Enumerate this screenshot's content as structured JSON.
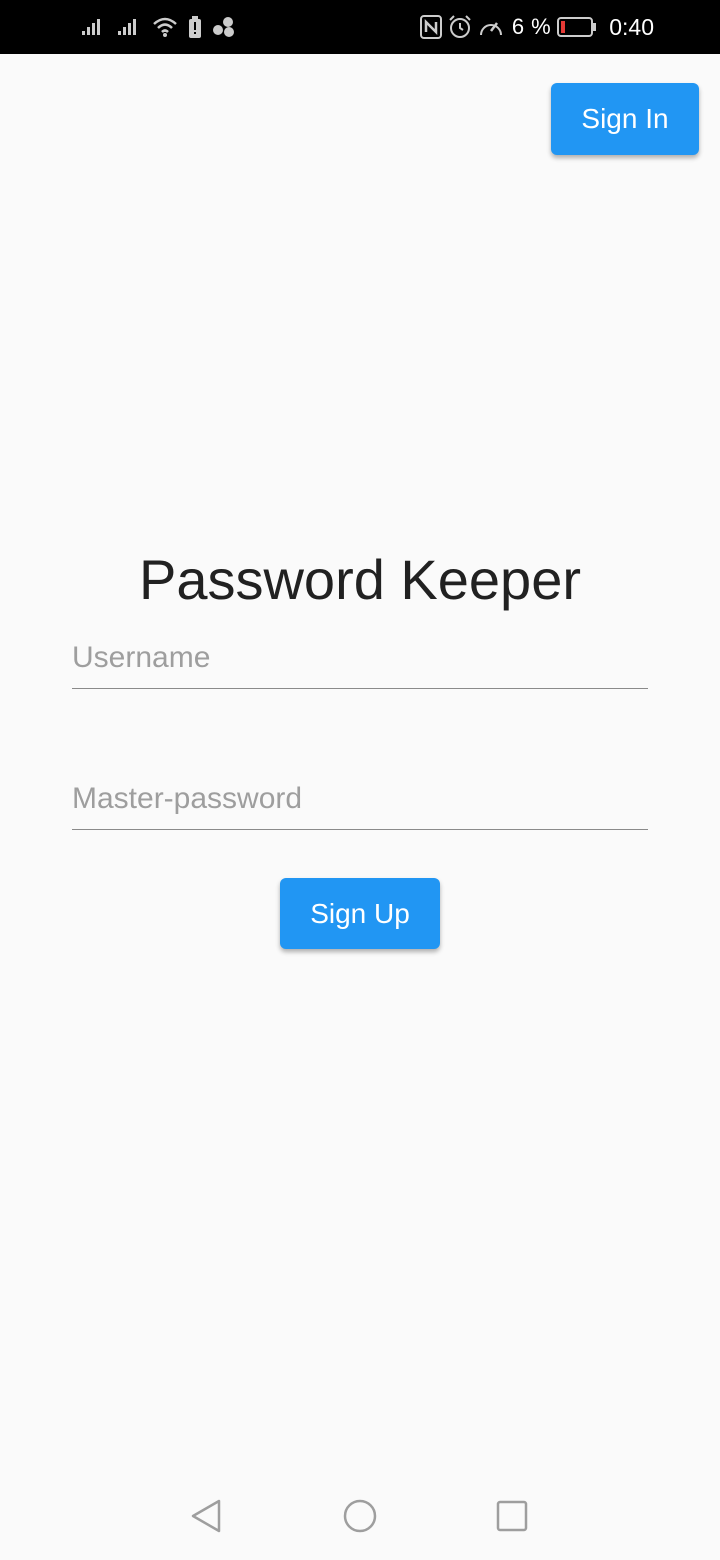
{
  "status_bar": {
    "battery_percent": "6 %",
    "time": "0:40",
    "icons": [
      "signal-icon",
      "signal-icon-2",
      "wifi-icon",
      "battery-alert-icon",
      "app-notification-icon",
      "nfc-icon",
      "alarm-icon",
      "data-speed-icon",
      "battery-icon"
    ],
    "battery_color": "#e53935"
  },
  "header": {
    "sign_in_label": "Sign In"
  },
  "main": {
    "title": "Password Keeper",
    "username_placeholder": "Username",
    "password_placeholder": "Master-password",
    "sign_up_label": "Sign Up"
  },
  "nav_bar": {
    "icons": [
      "back-icon",
      "home-icon",
      "recent-apps-icon"
    ]
  },
  "colors": {
    "accent": "#2196f3",
    "background": "#fafafa",
    "status_bar": "#000000"
  }
}
